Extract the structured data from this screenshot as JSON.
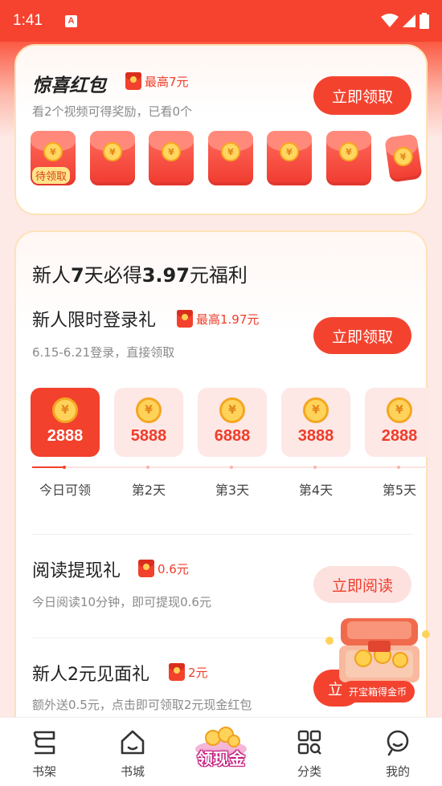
{
  "status_bar": {
    "time": "1:41",
    "indicator": "A"
  },
  "surprise_card": {
    "title": "惊喜红包",
    "max_tag": "最高7元",
    "subtitle": "看2个视频可得奖励，已看0个",
    "button": "立即领取",
    "pending_label": "待领取",
    "envelope_count": 7
  },
  "newbie_card": {
    "headline_prefix": "新人",
    "headline_days": "7",
    "headline_mid": "天必得",
    "headline_amount": "3.97",
    "headline_suffix": "元福利",
    "login_gift": {
      "title": "新人限时登录礼",
      "tag": "最高1.97元",
      "subtitle": "6.15-6.21登录，直接领取",
      "button": "立即领取"
    },
    "days": [
      {
        "value": "2888",
        "label": "今日可领",
        "active": true
      },
      {
        "value": "5888",
        "label": "第2天",
        "active": false
      },
      {
        "value": "6888",
        "label": "第3天",
        "active": false
      },
      {
        "value": "3888",
        "label": "第4天",
        "active": false
      },
      {
        "value": "2888",
        "label": "第5天",
        "active": false
      }
    ],
    "reading_gift": {
      "title": "阅读提现礼",
      "tag": "0.6元",
      "subtitle": "今日阅读10分钟，即可提现0.6元",
      "button": "立即阅读"
    },
    "meet_gift": {
      "title": "新人2元见面礼",
      "tag": "2元",
      "subtitle": "额外送0.5元，点击即可领取2元现金红包",
      "button": "立"
    }
  },
  "treasure": {
    "label": "开宝箱得金币"
  },
  "tabbar": {
    "items": [
      {
        "label": "书架",
        "icon": "bookshelf-icon"
      },
      {
        "label": "书城",
        "icon": "home-icon"
      },
      {
        "label": "领现金",
        "icon": "coins-icon"
      },
      {
        "label": "分类",
        "icon": "category-icon"
      },
      {
        "label": "我的",
        "icon": "profile-icon"
      }
    ]
  },
  "colors": {
    "accent": "#f3432f",
    "pink": "#fde1df",
    "status_bar": "#f5432f"
  }
}
